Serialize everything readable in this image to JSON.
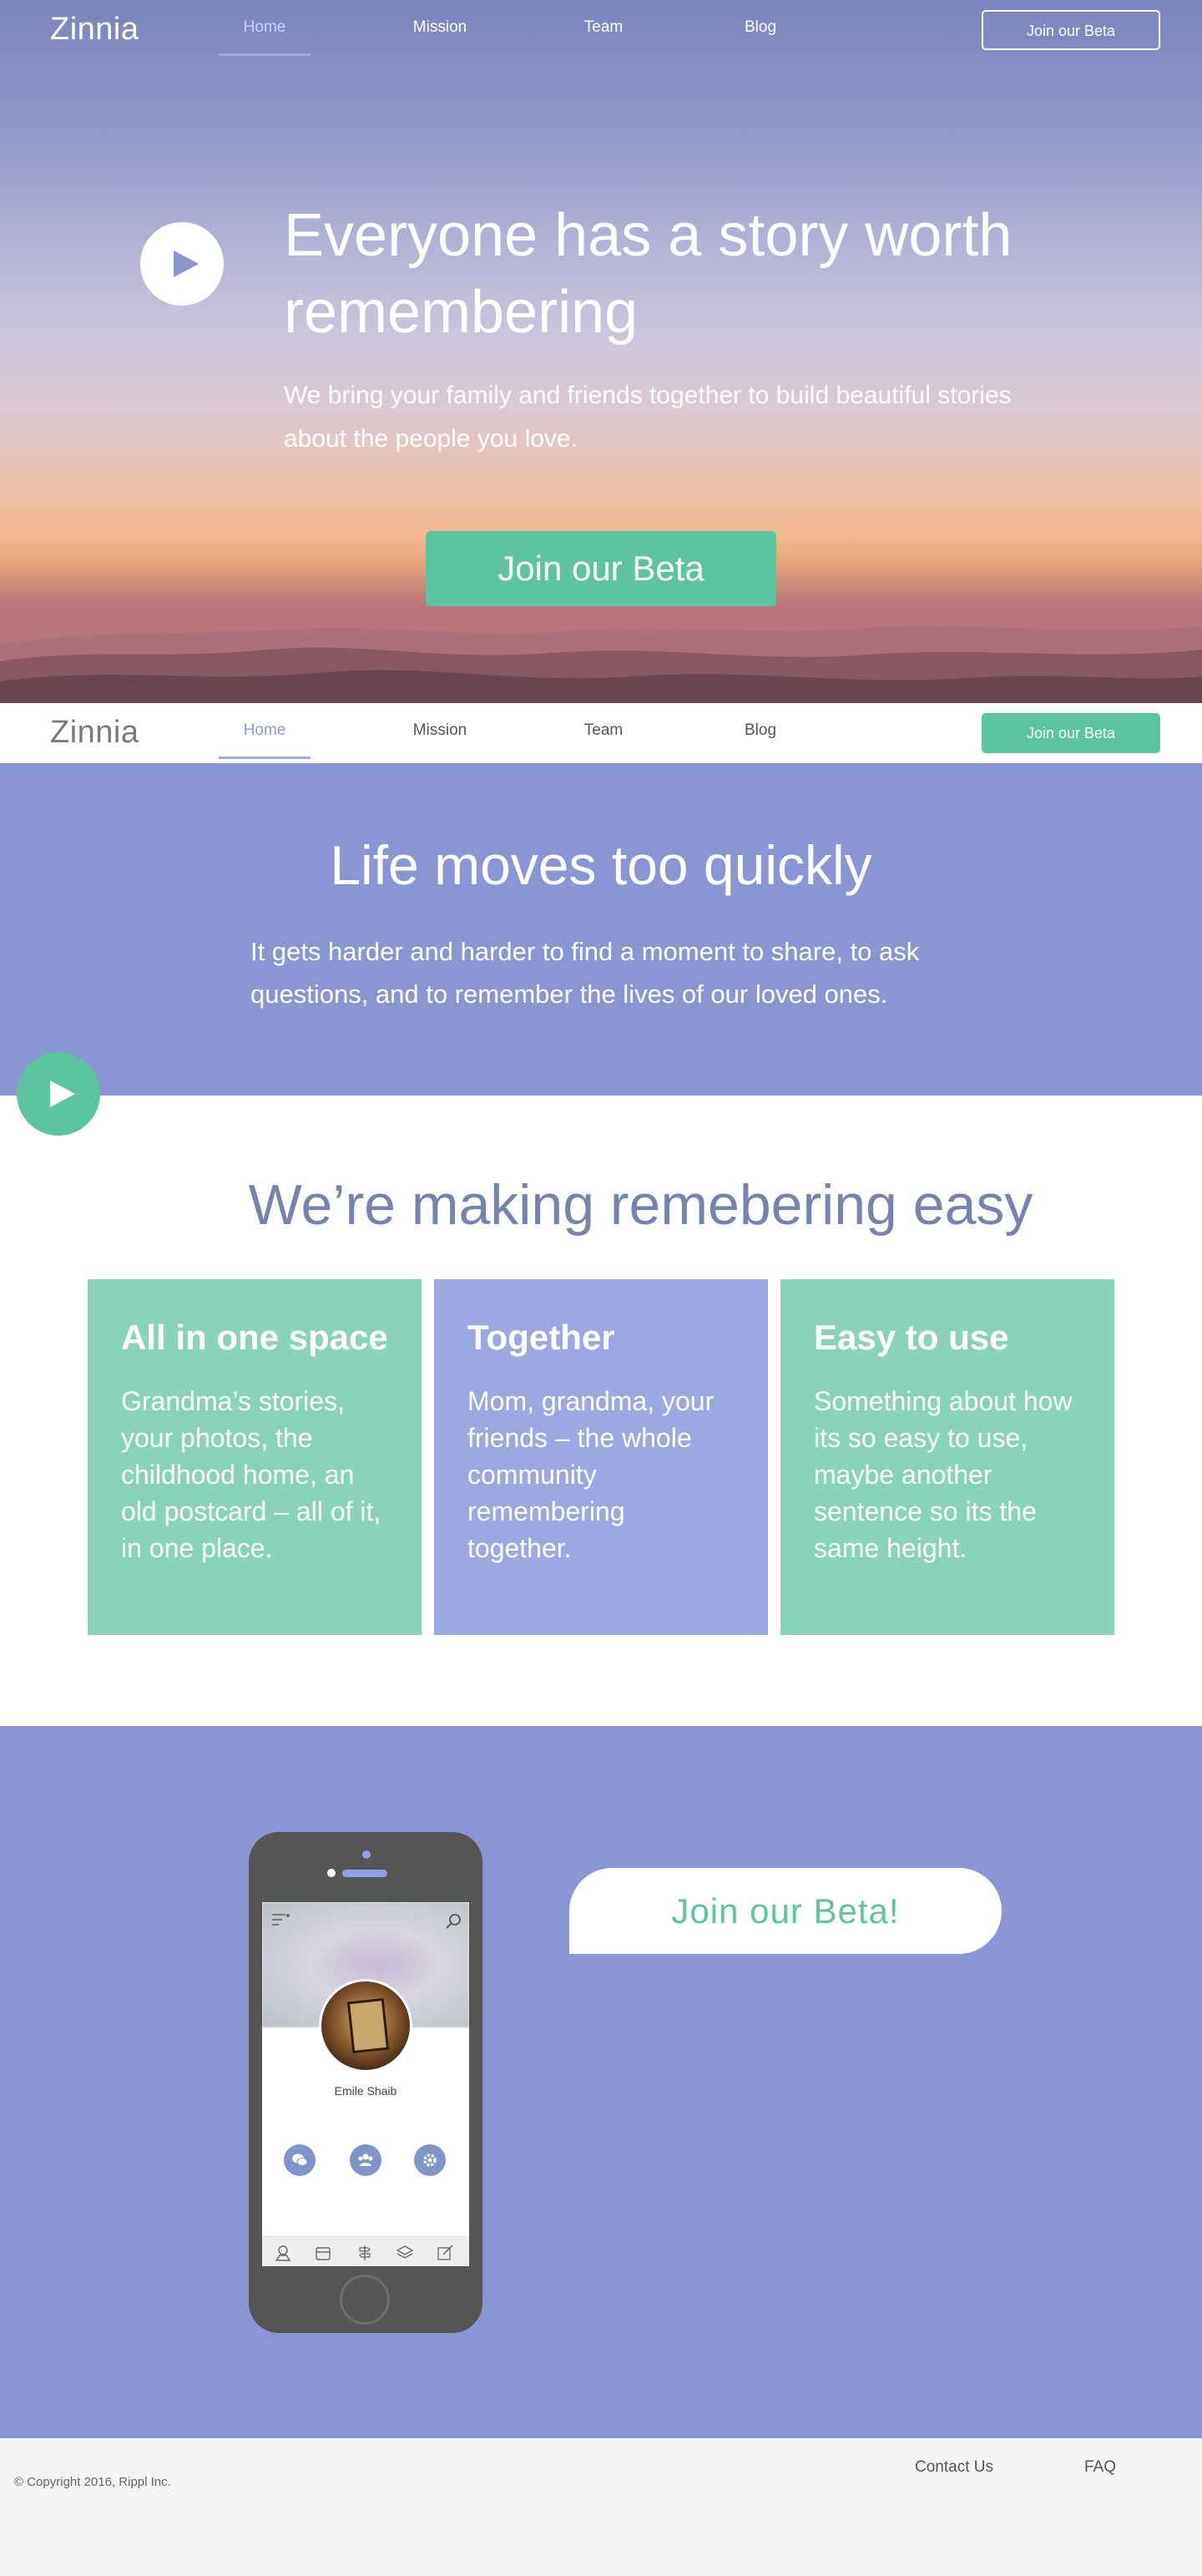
{
  "brand": "Zinnia",
  "nav": {
    "items": [
      {
        "label": "Home",
        "active": true
      },
      {
        "label": "Mission",
        "active": false
      },
      {
        "label": "Team",
        "active": false
      },
      {
        "label": "Blog",
        "active": false
      }
    ],
    "cta": "Join our Beta"
  },
  "hero": {
    "title": "Everyone has a story worth remembering",
    "subtitle": "We bring your family and friends together to build beautiful stories about the people you love.",
    "cta": "Join our Beta"
  },
  "life": {
    "title": "Life moves too quickly",
    "body": "It gets harder and harder to find a moment to share, to ask questions, and to remember the lives of our loved ones."
  },
  "features": {
    "title": "We’re making remebering easy",
    "cards": [
      {
        "title": "All in one space",
        "body": "Grandma’s stories, your photos, the childhood home, an old postcard – all of it, in one place."
      },
      {
        "title": "Together",
        "body": "Mom, grandma, your friends – the whole community remembering together."
      },
      {
        "title": "Easy to use",
        "body": "Something about how its so easy to use, maybe another sentence so its the same height."
      }
    ]
  },
  "beta": {
    "cta": "Join our Beta!",
    "phone": {
      "profile_name": "Emile Shaib"
    }
  },
  "footer": {
    "copyright": "© Copyright 2016, Rippl Inc.",
    "links": [
      "Contact Us",
      "FAQ"
    ]
  },
  "colors": {
    "accent_green": "#5dc4a1",
    "section_purple": "#8a96d3",
    "card_green": "#89d3b9",
    "card_purple": "#9ca8e1",
    "heading_slate": "#7583ae"
  }
}
